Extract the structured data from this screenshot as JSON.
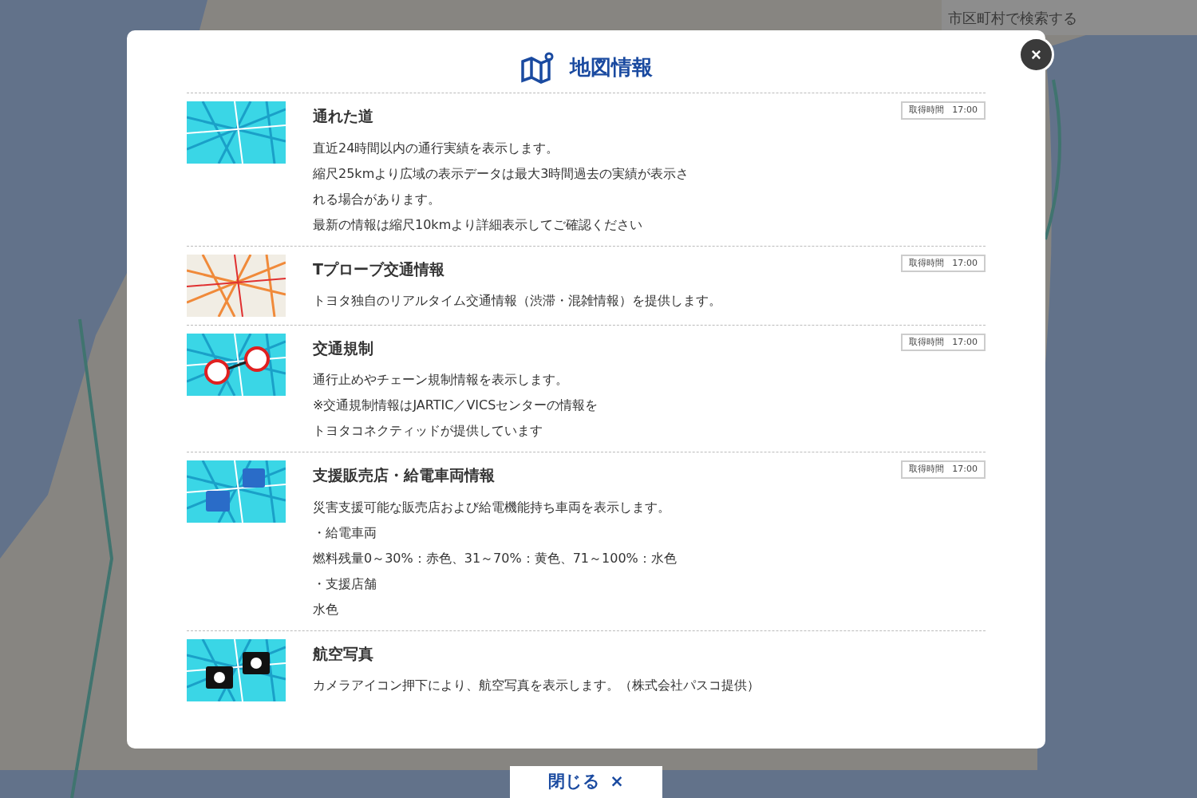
{
  "search": {
    "placeholder": "市区町村で検索する"
  },
  "dialog": {
    "title": "地図情報",
    "close_symbol": "×",
    "items": [
      {
        "title": "通れた道",
        "badge_label": "取得時間",
        "badge_time": "17:00",
        "lines": [
          "直近24時間以内の通行実績を表示します。",
          "縮尺25kmより広域の表示データは最大3時間過去の実績が表示さ",
          "れる場合があります。",
          "最新の情報は縮尺10kmより詳細表示してご確認ください"
        ]
      },
      {
        "title": "Tプローブ交通情報",
        "badge_label": "取得時間",
        "badge_time": "17:00",
        "lines": [
          "トヨタ独自のリアルタイム交通情報（渋滞・混雑情報）を提供します。"
        ]
      },
      {
        "title": "交通規制",
        "badge_label": "取得時間",
        "badge_time": "17:00",
        "lines": [
          "通行止めやチェーン規制情報を表示します。",
          "※交通規制情報はJARTIC／VICSセンターの情報を",
          "トヨタコネクティッドが提供しています"
        ]
      },
      {
        "title": "支援販売店・給電車両情報",
        "badge_label": "取得時間",
        "badge_time": "17:00",
        "lines": [
          "災害支援可能な販売店および給電機能持ち車両を表示します。",
          "・給電車両",
          "燃料残量0～30%：赤色、31～70%：黄色、71～100%：水色",
          "・支援店舗",
          "水色"
        ]
      },
      {
        "title": "航空写真",
        "lines": [
          "カメラアイコン押下により、航空写真を表示します。（株式会社パスコ提供）"
        ]
      }
    ]
  },
  "footer_button": {
    "label": "閉じる",
    "symbol": "×"
  }
}
